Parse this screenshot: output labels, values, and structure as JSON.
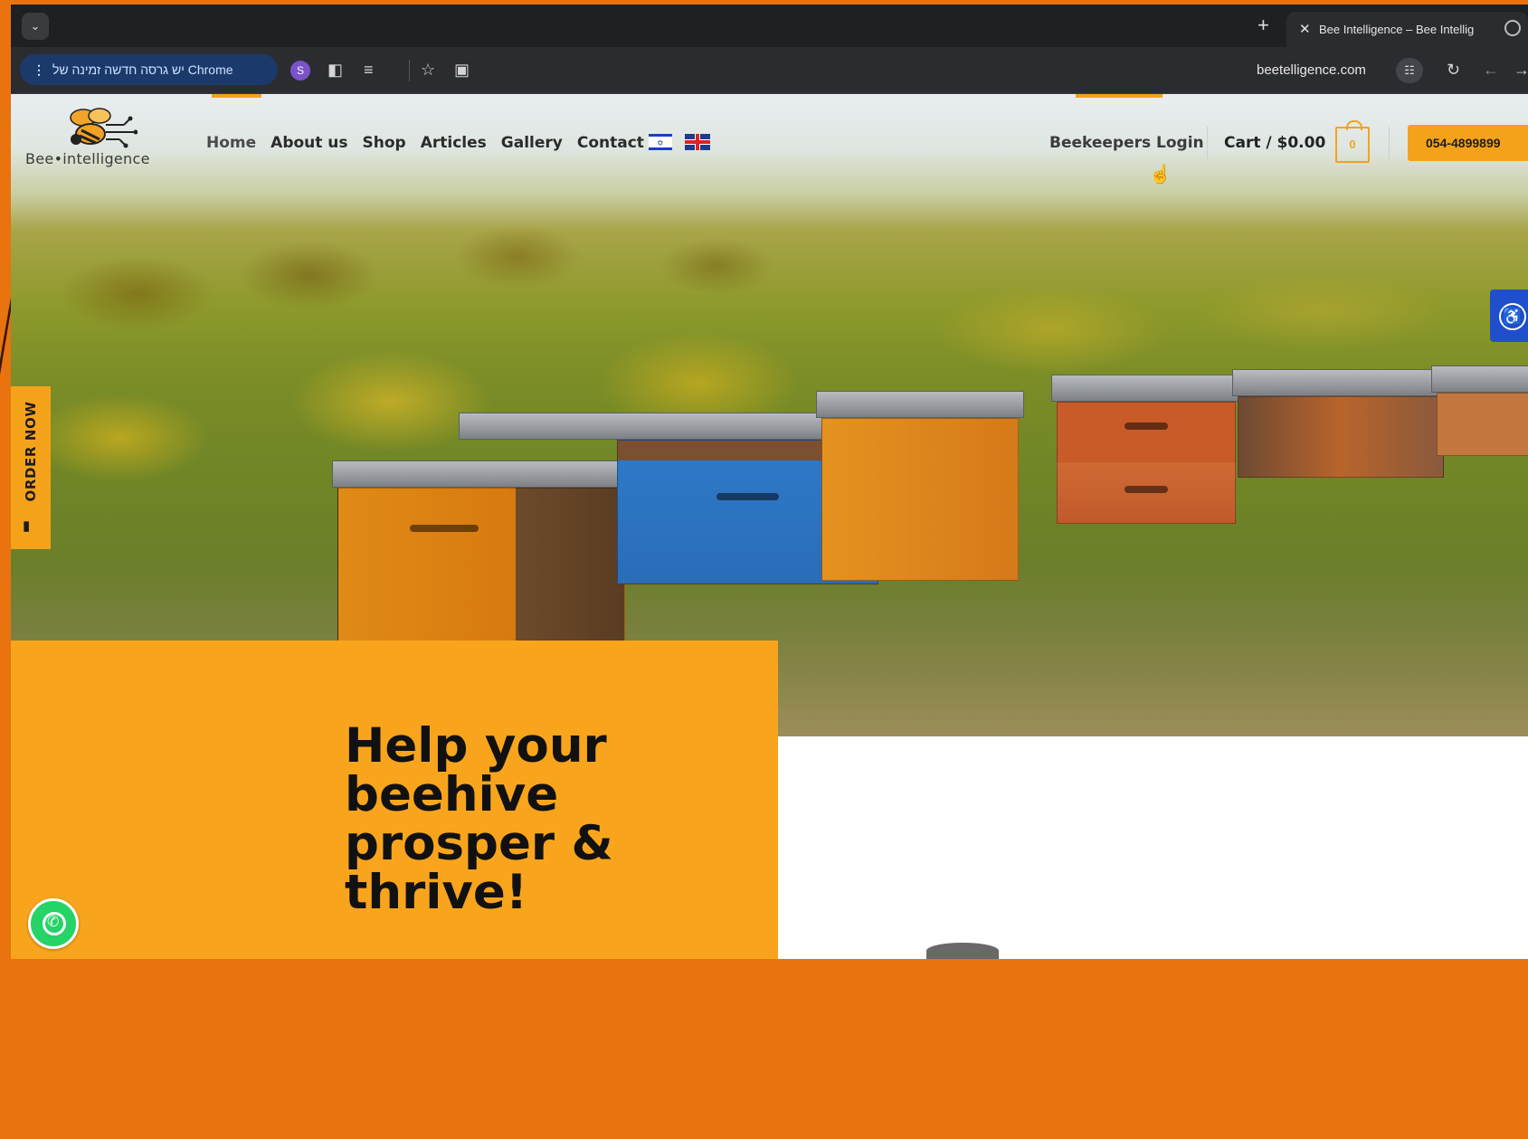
{
  "browser": {
    "tab_title": "Bee Intelligence – Bee Intellig",
    "new_tab_glyph": "+",
    "close_glyph": "✕",
    "update_chip": "יש גרסה חדשה זמינה של Chrome",
    "extension_badge": "S",
    "url": "beetelligence.com"
  },
  "site": {
    "logo_text": "Bee•intelligence",
    "nav": [
      "Home",
      "About us",
      "Shop",
      "Articles",
      "Gallery",
      "Contact"
    ],
    "login": "Beekeepers Login",
    "cart": "Cart / $0.00",
    "cart_count": "0",
    "phone": "054-4899899",
    "order_now": "ORDER NOW",
    "promo_title": "Help your beehive prosper & thrive!"
  },
  "icons": {
    "tab_menu": "chevron-down-icon",
    "sidebar": "side-panel-icon",
    "reading_list": "reading-list-icon",
    "bookmark": "star-icon",
    "cast": "cast-icon",
    "site_settings": "tune-icon",
    "reload": "reload-icon",
    "back": "back-arrow-icon",
    "forward": "forward-arrow-icon",
    "accessibility": "accessibility-icon",
    "whatsapp": "whatsapp-icon",
    "cart_bag": "shopping-bag-icon"
  },
  "colors": {
    "accent": "#f5a21b",
    "frame": "#e8730f",
    "browser_dark": "#1f2023",
    "a11y_blue": "#1f4fcc",
    "whatsapp_green": "#25d366"
  }
}
